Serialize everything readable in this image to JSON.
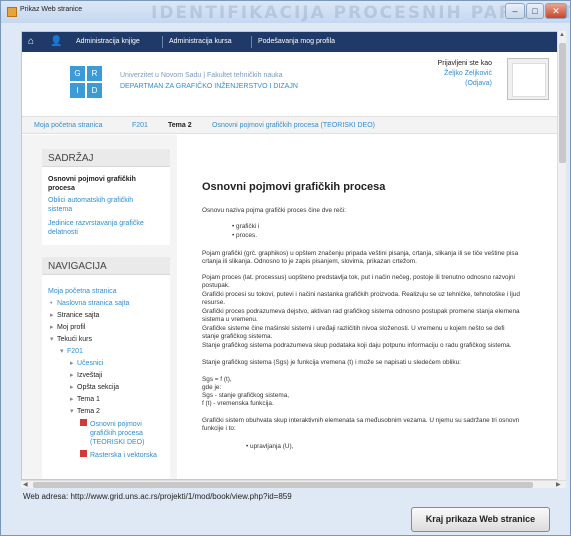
{
  "window": {
    "title": "Prikaz Web stranice",
    "watermark": "IDENTIFIKACIJA PROCESNIH PARAMETARA"
  },
  "navbar": {
    "links": [
      "Administracija knjige",
      "Administracija kursa",
      "Podešavanja mog profila"
    ]
  },
  "header": {
    "logo_letters": [
      "G",
      "R",
      "I",
      "D"
    ],
    "org_line1": "Univerzitet u Novom Sadu  |  Fakultet tehničkih nauka",
    "org_line2": "DEPARTMAN ZA GRAFIČKO INŽENJERSTVO I DIZAJN",
    "logged_label": "Prijavljeni ste kao",
    "user_name": "Željko Zeljković",
    "logout": "(Odjava)"
  },
  "breadcrumb": [
    "Moja početna stranica",
    "F201",
    "Tema 2",
    "Osnovni pojmovi grafičkih procesa (TEORISKI DEO)"
  ],
  "toc": {
    "title": "SADRŽAJ",
    "active": [
      "Osnovni pojmovi grafičkih",
      "procesa"
    ],
    "links": [
      [
        "Oblici automatskih grafičkih",
        "sistema"
      ],
      [
        "Jedinice razvrstavanja grafičke",
        "delatnosti"
      ]
    ]
  },
  "navigation": {
    "title": "NAVIGACIJA",
    "items": [
      {
        "label": "Moja početna stranica",
        "link": true,
        "bullet": ""
      },
      {
        "label": "Naslovna stranica sajta",
        "link": true,
        "bullet": "•"
      },
      {
        "label": "Stranice sajta",
        "link": false,
        "bullet": "▸"
      },
      {
        "label": "Moj profil",
        "link": false,
        "bullet": "▸"
      },
      {
        "label": "Tekući kurs",
        "link": false,
        "bullet": "▾"
      },
      {
        "label": "F201",
        "link": true,
        "bullet": "▾"
      },
      {
        "label": "Učesnici",
        "link": true,
        "bullet": "▸"
      },
      {
        "label": "Izveštaji",
        "link": false,
        "bullet": "▸"
      },
      {
        "label": "Opšta sekcija",
        "link": false,
        "bullet": "▸"
      },
      {
        "label": "Tema 1",
        "link": false,
        "bullet": "▸"
      },
      {
        "label": "Tema 2",
        "link": false,
        "bullet": "▾"
      }
    ],
    "pages": [
      [
        "Osnovni pojmovi",
        "grafičkih procesa",
        "(TEORISKI DEO)"
      ],
      [
        "Rasterska i vektorska"
      ]
    ]
  },
  "main": {
    "heading": "Osnovni pojmovi grafičkih procesa",
    "intro": "Osnovu naziva pojma grafički proces čine dve reči:",
    "bullets": [
      "grafički i",
      "proces."
    ],
    "paragraphs": [
      "Pojam grafički (grč. graphikos) u opštem značenju pripada veštini pisanja, crtanja, slikanja ili se tiče veštine pisa",
      "crtanja ili slikanja. Odnosno to je zapis pisanjem, slovima, prikazan crtežom.",
      "Pojam proces (lat. processus) uopšteno predstavlja tok, put i način nečeg, postoje ili trenutno odnosno razvojni",
      "postupak.",
      "Grafički procesi su tokovi, putevi i načini nastanka grafičkih proizvoda. Realizuju se uz tehničke, tehnološke i ljud",
      "resurse.",
      "Grafički proces podrazumeva dejstvo, aktivan rad grafičkog sistema odnosno postupak promene stanja elemena",
      "sistema u vremenu.",
      "Grafičke sisteme čine mašinski sistemi i uređaji različitih nivoa složenosti. U vremenu u kojem nešto se defi",
      "stanje grafičkog sistema.",
      "Stanje grafičkog sistema podrazumeva skup podataka koji daju potpunu informaciju o radu grafičkog sistema.",
      "Stanje grafičkog sistema (Sgs) je funkcija vremena (t) i može se napisati u sledećem obliku:",
      "Sgs = f (t),",
      "gde je:",
      "Sgs - stanje grafičkog sistema,",
      "f (t) - vremenska funkcija.",
      "Grafički sistem obuhvata skup interaktivnih elemenata sa međusobnim vezama. U njemu su sadržane tri osnovn",
      "funkcije i to:"
    ],
    "last_bullet": "upravljanja (U),"
  },
  "address_label": "Web adresa:",
  "address_url": "http://www.grid.uns.ac.rs/projekti/1/mod/book/view.php?id=859",
  "end_button": "Kraj prikaza Web stranice"
}
